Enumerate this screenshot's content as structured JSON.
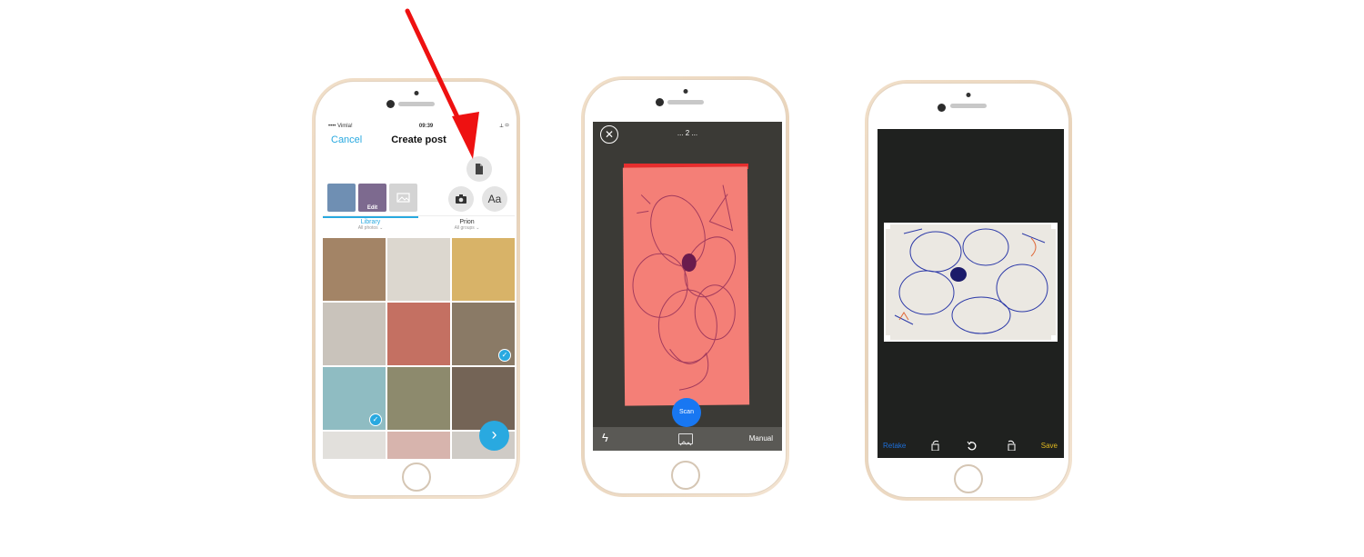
{
  "phone1": {
    "status": {
      "carrier": "•••• Vimla!",
      "time": "09:39",
      "battery": "⟂ ▭"
    },
    "nav": {
      "cancel": "Cancel",
      "title": "Create post"
    },
    "thumbs": [
      {
        "label": "",
        "color": "#6f8fb3"
      },
      {
        "label": "Edit",
        "color": "#7d6a8f"
      },
      {
        "label": "",
        "color": "#cfcfcf"
      }
    ],
    "tools": {
      "document_icon": "document-icon",
      "camera_icon": "camera-icon",
      "text": "Aa"
    },
    "tabs": [
      {
        "title": "Library",
        "sub": "All photos",
        "color": "#29a9e0"
      },
      {
        "title": "Prion",
        "sub": "All groups",
        "color": "#333333"
      }
    ],
    "grid": [
      {
        "color": "#a38466",
        "checked": false
      },
      {
        "color": "#dcd7cf",
        "checked": false
      },
      {
        "color": "#d8b368",
        "checked": false
      },
      {
        "color": "#c9c3bb",
        "checked": false
      },
      {
        "color": "#c47062",
        "checked": false
      },
      {
        "color": "#8a7a66",
        "checked": true
      },
      {
        "color": "#8fbcc2",
        "checked": true
      },
      {
        "color": "#8d8a6d",
        "checked": false
      },
      {
        "color": "#746456",
        "checked": false
      },
      {
        "color": "#e2e0dc",
        "checked": false
      },
      {
        "color": "#d7b4ad",
        "checked": false
      },
      {
        "color": "#cfcbc6",
        "checked": false
      }
    ],
    "fab": "›"
  },
  "phone2": {
    "counter": "... 2 ...",
    "close": "✕",
    "scan": "Scan",
    "manual": "Manual",
    "flash": "ϟ"
  },
  "phone3": {
    "retake": "Retake",
    "save": "Save",
    "icons": [
      "rotate-left-icon",
      "undo-icon",
      "rotate-right-icon"
    ],
    "colors": {
      "retake": "#1d6fd9",
      "save": "#e0b81f"
    }
  }
}
